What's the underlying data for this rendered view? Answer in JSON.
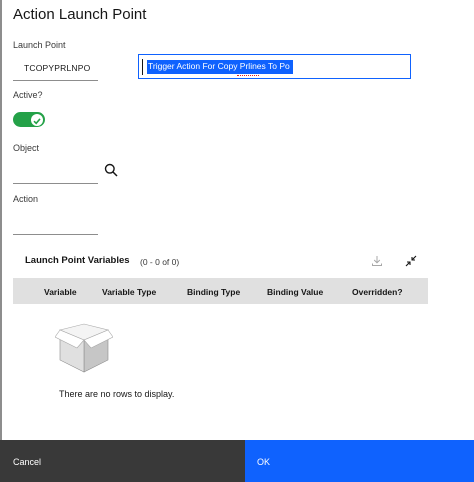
{
  "dialog": {
    "title": "Action Launch Point"
  },
  "fields": {
    "launch_point_label": "Launch Point",
    "launch_point_value": "TCOPYPRLNPO",
    "description_value": "Trigger Action For Copy Prlines To Po",
    "active_label": "Active?",
    "active_value": true,
    "object_label": "Object",
    "object_value": "",
    "action_label": "Action",
    "action_value": ""
  },
  "variables_table": {
    "title": "Launch Point Variables",
    "count": "(0 - 0 of 0)",
    "columns": [
      "Variable",
      "Variable Type",
      "Binding Type",
      "Binding Value",
      "Overridden?"
    ],
    "rows": [],
    "empty_message": "There are no rows to display."
  },
  "icons": {
    "object_lookup": "search-icon",
    "download": "download-icon",
    "collapse": "collapse-icon",
    "empty_state": "empty-box-icon",
    "toggle": "check-icon"
  },
  "footer": {
    "cancel_label": "Cancel",
    "ok_label": "OK"
  },
  "colors": {
    "primary": "#0f62fe",
    "toggle_on": "#24a148",
    "secondary_button": "#393939",
    "table_header": "#e0e0e0"
  }
}
